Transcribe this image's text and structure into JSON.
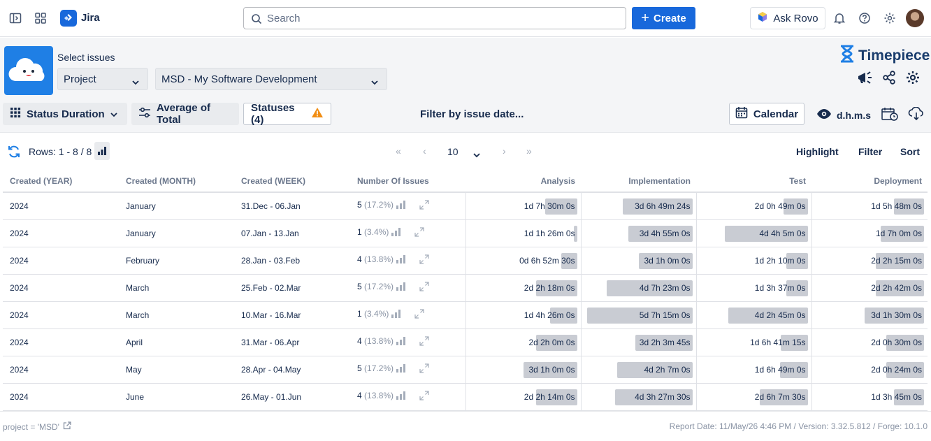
{
  "topbar": {
    "app_name": "Jira",
    "search_placeholder": "Search",
    "create_label": "Create",
    "ask_rovo_label": "Ask Rovo"
  },
  "app": {
    "brand": "Timepiece",
    "select_issues_label": "Select issues",
    "scope_select": "Project",
    "project_select": "MSD - My Software Development",
    "status_duration_label": "Status Duration",
    "average_label": "Average of Total",
    "statuses_label": "Statuses (4)",
    "filter_date_label": "Filter by issue date...",
    "calendar_label": "Calendar",
    "time_format_label": "d.h.m.s"
  },
  "controls": {
    "rows_label": "Rows: 1 - 8 / 8",
    "page_size": "10",
    "highlight_label": "Highlight",
    "filter_label": "Filter",
    "sort_label": "Sort"
  },
  "table": {
    "columns": [
      "Created (YEAR)",
      "Created (MONTH)",
      "Created (WEEK)",
      "Number Of Issues",
      "Analysis",
      "Implementation",
      "Test",
      "Deployment"
    ],
    "rows": [
      {
        "year": "2024",
        "month": "January",
        "week": "31.Dec - 06.Jan",
        "count": "5",
        "pct": "(17.2%)",
        "analysis": "1d 7h 30m 0s",
        "analysis_level": 0.3,
        "implementation": "3d 6h 49m 24s",
        "implementation_level": 0.65,
        "test": "2d 0h 49m 0s",
        "test_level": 0.23,
        "deployment": "1d 5h 48m 0s",
        "deployment_level": 0.28
      },
      {
        "year": "2024",
        "month": "January",
        "week": "07.Jan - 13.Jan",
        "count": "1",
        "pct": "(3.4%)",
        "analysis": "1d 1h 26m 0s",
        "analysis_level": 0.03,
        "implementation": "3d 4h 55m 0s",
        "implementation_level": 0.6,
        "test": "4d 4h 5m 0s",
        "test_level": 0.77,
        "deployment": "1d 7h 0m 0s",
        "deployment_level": 0.4
      },
      {
        "year": "2024",
        "month": "February",
        "week": "28.Jan - 03.Feb",
        "count": "4",
        "pct": "(13.8%)",
        "analysis": "0d 6h 52m 30s",
        "analysis_level": 0.15,
        "implementation": "3d 1h 0m 0s",
        "implementation_level": 0.5,
        "test": "1d 2h 10m 0s",
        "test_level": 0.2,
        "deployment": "2d 2h 15m 0s",
        "deployment_level": 0.45
      },
      {
        "year": "2024",
        "month": "March",
        "week": "25.Feb - 02.Mar",
        "count": "5",
        "pct": "(17.2%)",
        "analysis": "2d 2h 18m 0s",
        "analysis_level": 0.38,
        "implementation": "4d 7h 23m 0s",
        "implementation_level": 0.8,
        "test": "1d 3h 37m 0s",
        "test_level": 0.2,
        "deployment": "2d 2h 42m 0s",
        "deployment_level": 0.45
      },
      {
        "year": "2024",
        "month": "March",
        "week": "10.Mar - 16.Mar",
        "count": "1",
        "pct": "(3.4%)",
        "analysis": "1d 4h 26m 0s",
        "analysis_level": 0.25,
        "implementation": "5d 7h 15m 0s",
        "implementation_level": 0.98,
        "test": "4d 2h 45m 0s",
        "test_level": 0.74,
        "deployment": "3d 1h 30m 0s",
        "deployment_level": 0.55
      },
      {
        "year": "2024",
        "month": "April",
        "week": "31.Mar - 06.Apr",
        "count": "4",
        "pct": "(13.8%)",
        "analysis": "2d 2h 0m 0s",
        "analysis_level": 0.38,
        "implementation": "3d 2h 3m 45s",
        "implementation_level": 0.53,
        "test": "1d 6h 41m 15s",
        "test_level": 0.25,
        "deployment": "2d 0h 30m 0s",
        "deployment_level": 0.35
      },
      {
        "year": "2024",
        "month": "May",
        "week": "28.Apr - 04.May",
        "count": "5",
        "pct": "(17.2%)",
        "analysis": "3d 1h 0m 0s",
        "analysis_level": 0.5,
        "implementation": "4d 2h 7m 0s",
        "implementation_level": 0.7,
        "test": "1d 6h 49m 0s",
        "test_level": 0.26,
        "deployment": "2d 0h 24m 0s",
        "deployment_level": 0.35
      },
      {
        "year": "2024",
        "month": "June",
        "week": "26.May - 01.Jun",
        "count": "4",
        "pct": "(13.8%)",
        "analysis": "2d 2h 14m 0s",
        "analysis_level": 0.38,
        "implementation": "4d 3h 27m 30s",
        "implementation_level": 0.72,
        "test": "2d 6h 7m 30s",
        "test_level": 0.45,
        "deployment": "1d 3h 45m 0s",
        "deployment_level": 0.28
      }
    ]
  },
  "footer": {
    "jql": "project = 'MSD'",
    "report_info": "Report Date: 11/May/26 4:46 PM / Version: 3.32.5.812 / Forge: 10.1.0"
  }
}
